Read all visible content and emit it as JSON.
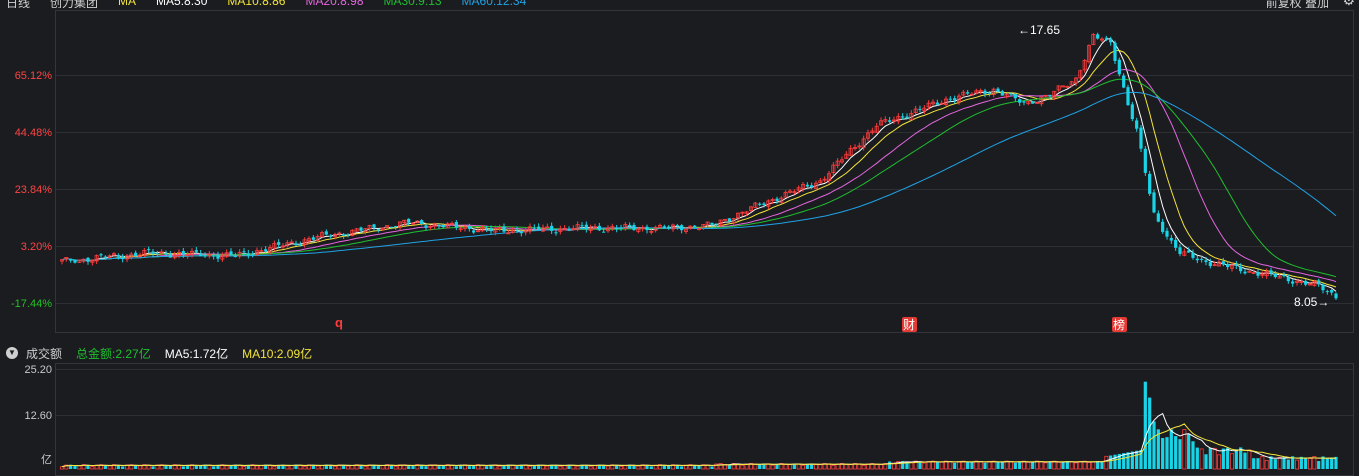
{
  "header": {
    "period": "日线",
    "stock_name": "创力集团",
    "ma_label": "MA",
    "ma5": "MA5:8.30",
    "ma10": "MA10:8.86",
    "ma20": "MA20:8.98",
    "ma30": "MA30:9.13",
    "ma60": "MA60:12.34",
    "adjust": "前复权",
    "overlay": "叠加"
  },
  "colors": {
    "up": "#ff3b3b",
    "down": "#19d3e6",
    "ma5": "#ffffff",
    "ma10": "#f3e43a",
    "ma20": "#e566e0",
    "ma30": "#1fbf2f",
    "ma60": "#1fa3e6",
    "grid": "#2e2f35"
  },
  "price_axis": {
    "ticks": [
      "65.12%",
      "44.48%",
      "23.84%",
      "3.20%",
      "-17.44%"
    ]
  },
  "annotations": {
    "high": "←17.65",
    "low": "8.05→"
  },
  "markers": {
    "q": "q",
    "cai": "财",
    "bang": "榜"
  },
  "volume_header": {
    "title": "成交额",
    "total": "总金额:2.27亿",
    "ma5": "MA5:1.72亿",
    "ma10": "MA10:2.09亿"
  },
  "volume_axis": {
    "ticks": [
      "25.20",
      "12.60"
    ],
    "unit": "亿"
  },
  "chart_data": {
    "type": "candlestick",
    "price_high": 17.65,
    "price_low": 8.05,
    "y_ticks_percent": [
      65.12,
      44.48,
      23.84,
      3.2,
      -17.44
    ],
    "volume_ylim": [
      0,
      25.2
    ],
    "volume_ticks": [
      25.2,
      12.6
    ],
    "series": [
      {
        "name": "MA5",
        "last": 8.3
      },
      {
        "name": "MA10",
        "last": 8.86
      },
      {
        "name": "MA20",
        "last": 8.98
      },
      {
        "name": "MA30",
        "last": 9.13
      },
      {
        "name": "MA60",
        "last": 12.34
      }
    ],
    "volume_summary": {
      "total": 2.27,
      "ma5": 1.72,
      "ma10": 2.09
    }
  }
}
